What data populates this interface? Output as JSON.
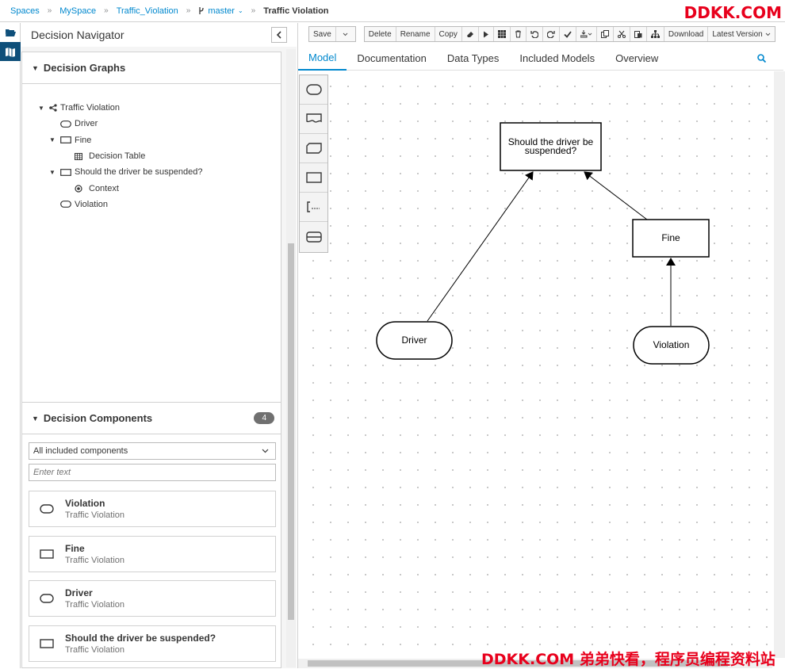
{
  "breadcrumb": {
    "items": [
      "Spaces",
      "MySpace",
      "Traffic_Violation"
    ],
    "branch": "master",
    "current": "Traffic Violation"
  },
  "watermark_top": "DDKK.COM",
  "watermark_bottom": "DDKK.COM 弟弟快看，程序员编程资料站",
  "navigator": {
    "title": "Decision Navigator",
    "graphs_title": "Decision Graphs",
    "tree": {
      "root": "Traffic Violation",
      "driver": "Driver",
      "fine": "Fine",
      "decision_table": "Decision Table",
      "suspended": "Should the driver be suspended?",
      "context": "Context",
      "violation": "Violation"
    },
    "components_title": "Decision Components",
    "components_count": "4",
    "filter_value": "All included components",
    "filter_placeholder": "Enter text",
    "components": [
      {
        "name": "Violation",
        "source": "Traffic Violation",
        "icon": "input-data-icon"
      },
      {
        "name": "Fine",
        "source": "Traffic Violation",
        "icon": "decision-icon"
      },
      {
        "name": "Driver",
        "source": "Traffic Violation",
        "icon": "input-data-icon"
      },
      {
        "name": "Should the driver be suspended?",
        "source": "Traffic Violation",
        "icon": "decision-icon"
      }
    ]
  },
  "toolbar": {
    "save": "Save",
    "delete": "Delete",
    "rename": "Rename",
    "copy": "Copy",
    "download": "Download",
    "latest_version": "Latest Version"
  },
  "tabs": [
    "Model",
    "Documentation",
    "Data Types",
    "Included Models",
    "Overview"
  ],
  "diagram": {
    "decision_suspended_line1": "Should the driver be",
    "decision_suspended_line2": "suspended?",
    "decision_fine": "Fine",
    "input_driver": "Driver",
    "input_violation": "Violation"
  },
  "colors": {
    "accent": "#0088ce",
    "rail_active": "#0e4f7a",
    "watermark": "#e8001c"
  }
}
